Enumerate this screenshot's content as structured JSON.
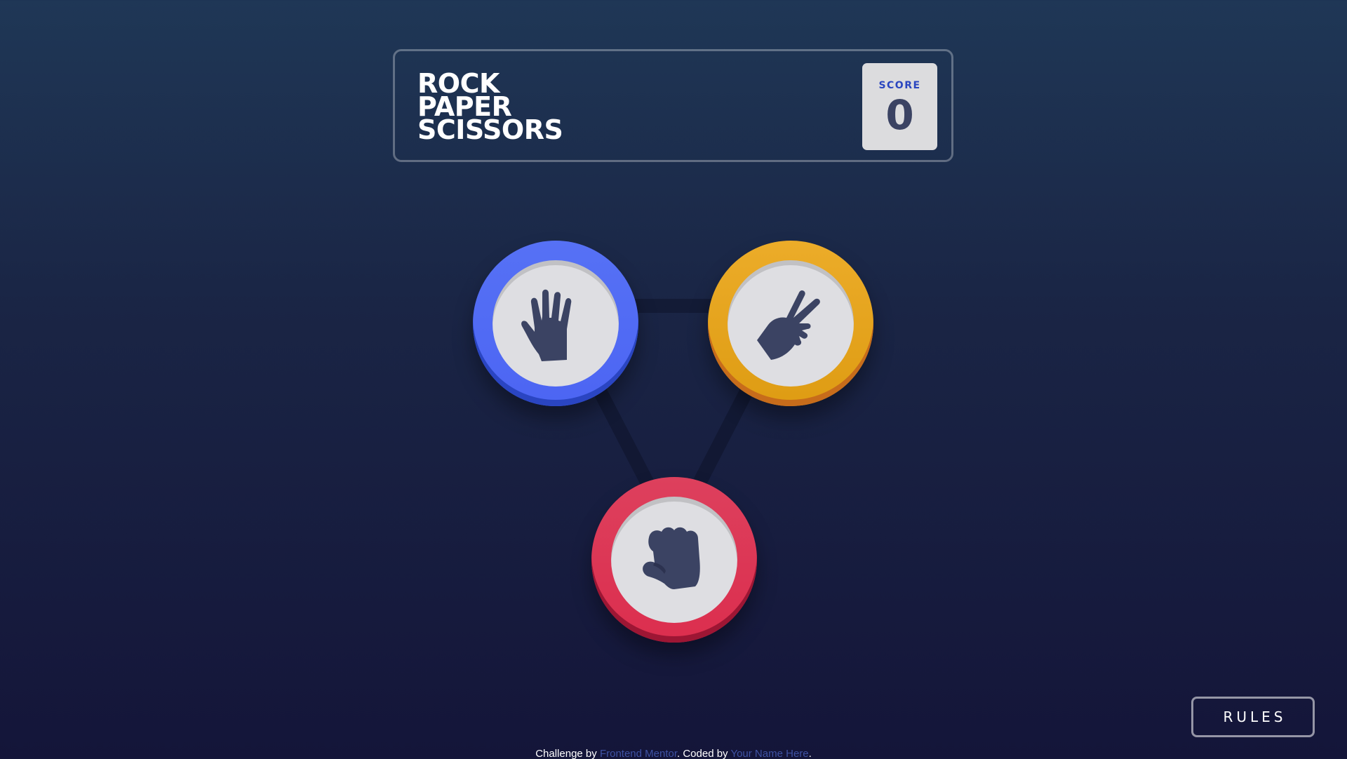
{
  "header": {
    "title_lines": [
      "ROCK",
      "PAPER",
      "SCISSORS"
    ],
    "score_label": "SCORE",
    "score_value": "0"
  },
  "tokens": [
    {
      "name": "paper",
      "icon": "paper-hand-icon",
      "ring_color": "#4c65f3"
    },
    {
      "name": "scissors",
      "icon": "scissors-hand-icon",
      "ring_color": "#de9c13"
    },
    {
      "name": "rock",
      "icon": "rock-fist-icon",
      "ring_color": "#dc2e4e"
    }
  ],
  "rules_button": {
    "label": "RULES"
  },
  "attribution": {
    "prefix": "Challenge by ",
    "link1": "Frontend Mentor",
    "middle": ". Coded by ",
    "link2": "Your Name Here",
    "suffix": "."
  },
  "colors": {
    "background_top": "#1f3756",
    "background_bottom": "#141539",
    "score_label": "#2a46c0",
    "score_value": "#3b4363",
    "link": "#3e52a3"
  }
}
